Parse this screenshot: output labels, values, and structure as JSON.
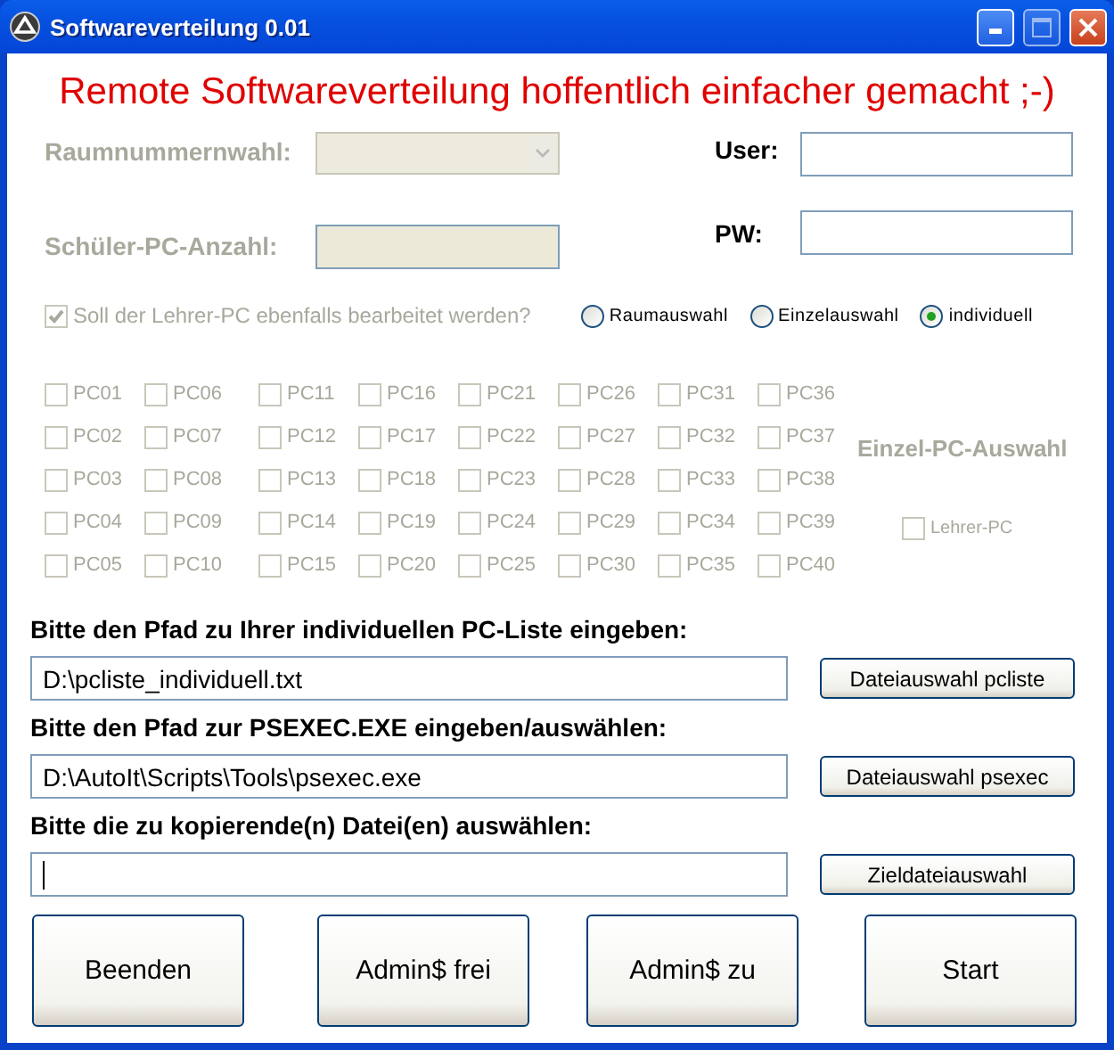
{
  "window": {
    "title": "Softwareverteilung 0.01"
  },
  "headline": "Remote Softwareverteilung hoffentlich einfacher gemacht ;-)",
  "room_select": {
    "label": "Raumnummernwahl:",
    "disabled": true
  },
  "pc_count": {
    "label": "Schüler-PC-Anzahl:",
    "disabled": true
  },
  "user": {
    "label": "User:"
  },
  "password": {
    "label": "PW:"
  },
  "teacher_option": {
    "label": "Soll der Lehrer-PC ebenfalls bearbeitet werden?",
    "checked": true,
    "disabled": true
  },
  "modes": [
    {
      "label": "Raumauswahl",
      "selected": false
    },
    {
      "label": "Einzelauswahl",
      "selected": false
    },
    {
      "label": "individuell",
      "selected": true
    }
  ],
  "pc_selection": {
    "title": "Einzel-PC-Auswahl",
    "disabled": true,
    "pcs": [
      {
        "label": "PC01",
        "checked": false
      },
      {
        "label": "PC02",
        "checked": false
      },
      {
        "label": "PC03",
        "checked": false
      },
      {
        "label": "PC04",
        "checked": false
      },
      {
        "label": "PC05",
        "checked": false
      },
      {
        "label": "PC06",
        "checked": false
      },
      {
        "label": "PC07",
        "checked": false
      },
      {
        "label": "PC08",
        "checked": false
      },
      {
        "label": "PC09",
        "checked": false
      },
      {
        "label": "PC10",
        "checked": false
      },
      {
        "label": "PC11",
        "checked": false
      },
      {
        "label": "PC12",
        "checked": false
      },
      {
        "label": "PC13",
        "checked": false
      },
      {
        "label": "PC14",
        "checked": false
      },
      {
        "label": "PC15",
        "checked": false
      },
      {
        "label": "PC16",
        "checked": false
      },
      {
        "label": "PC17",
        "checked": false
      },
      {
        "label": "PC18",
        "checked": false
      },
      {
        "label": "PC19",
        "checked": false
      },
      {
        "label": "PC20",
        "checked": false
      },
      {
        "label": "PC21",
        "checked": false
      },
      {
        "label": "PC22",
        "checked": false
      },
      {
        "label": "PC23",
        "checked": false
      },
      {
        "label": "PC24",
        "checked": false
      },
      {
        "label": "PC25",
        "checked": false
      },
      {
        "label": "PC26",
        "checked": false
      },
      {
        "label": "PC27",
        "checked": false
      },
      {
        "label": "PC28",
        "checked": false
      },
      {
        "label": "PC29",
        "checked": false
      },
      {
        "label": "PC30",
        "checked": false
      },
      {
        "label": "PC31",
        "checked": false
      },
      {
        "label": "PC32",
        "checked": false
      },
      {
        "label": "PC33",
        "checked": false
      },
      {
        "label": "PC34",
        "checked": false
      },
      {
        "label": "PC35",
        "checked": false
      },
      {
        "label": "PC36",
        "checked": false
      },
      {
        "label": "PC37",
        "checked": false
      },
      {
        "label": "PC38",
        "checked": false
      },
      {
        "label": "PC39",
        "checked": false
      },
      {
        "label": "PC40",
        "checked": false
      }
    ],
    "teacher_pc": {
      "label": "Lehrer-PC",
      "checked": false
    }
  },
  "paths": [
    {
      "label": "Bitte den Pfad zu Ihrer individuellen PC-Liste eingeben:",
      "value": "D:\\pcliste_individuell.txt",
      "button": "Dateiauswahl pcliste"
    },
    {
      "label": "Bitte den Pfad zur PSEXEC.EXE eingeben/auswählen:",
      "value": "D:\\AutoIt\\Scripts\\Tools\\psexec.exe",
      "button": "Dateiauswahl psexec"
    },
    {
      "label": "Bitte die zu kopierende(n) Datei(en) auswählen:",
      "focused": true,
      "button": "Zieldateiauswahl"
    }
  ],
  "buttons": [
    "Beenden",
    "Admin$ frei",
    "Admin$ zu",
    "Start"
  ]
}
